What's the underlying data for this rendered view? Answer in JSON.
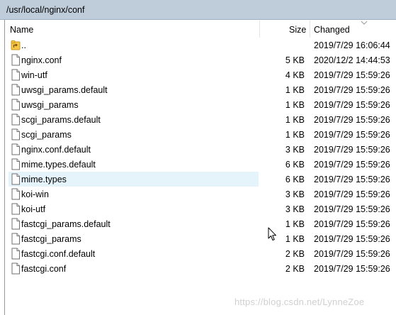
{
  "path": "/usr/local/nginx/conf",
  "columns": {
    "name": "Name",
    "size": "Size",
    "changed": "Changed"
  },
  "files": [
    {
      "name": "..",
      "size": "",
      "changed": "2019/7/29 16:06:44",
      "icon": "parent-folder-icon"
    },
    {
      "name": "nginx.conf",
      "size": "5 KB",
      "changed": "2020/12/2 14:44:53",
      "icon": "file-icon"
    },
    {
      "name": "win-utf",
      "size": "4 KB",
      "changed": "2019/7/29 15:59:26",
      "icon": "file-icon"
    },
    {
      "name": "uwsgi_params.default",
      "size": "1 KB",
      "changed": "2019/7/29 15:59:26",
      "icon": "file-icon"
    },
    {
      "name": "uwsgi_params",
      "size": "1 KB",
      "changed": "2019/7/29 15:59:26",
      "icon": "file-icon"
    },
    {
      "name": "scgi_params.default",
      "size": "1 KB",
      "changed": "2019/7/29 15:59:26",
      "icon": "file-icon"
    },
    {
      "name": "scgi_params",
      "size": "1 KB",
      "changed": "2019/7/29 15:59:26",
      "icon": "file-icon"
    },
    {
      "name": "nginx.conf.default",
      "size": "3 KB",
      "changed": "2019/7/29 15:59:26",
      "icon": "file-icon"
    },
    {
      "name": "mime.types.default",
      "size": "6 KB",
      "changed": "2019/7/29 15:59:26",
      "icon": "file-icon"
    },
    {
      "name": "mime.types",
      "size": "6 KB",
      "changed": "2019/7/29 15:59:26",
      "icon": "file-icon",
      "selected": true
    },
    {
      "name": "koi-win",
      "size": "3 KB",
      "changed": "2019/7/29 15:59:26",
      "icon": "file-icon"
    },
    {
      "name": "koi-utf",
      "size": "3 KB",
      "changed": "2019/7/29 15:59:26",
      "icon": "file-icon"
    },
    {
      "name": "fastcgi_params.default",
      "size": "1 KB",
      "changed": "2019/7/29 15:59:26",
      "icon": "file-icon"
    },
    {
      "name": "fastcgi_params",
      "size": "1 KB",
      "changed": "2019/7/29 15:59:26",
      "icon": "file-icon"
    },
    {
      "name": "fastcgi.conf.default",
      "size": "2 KB",
      "changed": "2019/7/29 15:59:26",
      "icon": "file-icon"
    },
    {
      "name": "fastcgi.conf",
      "size": "2 KB",
      "changed": "2019/7/29 15:59:26",
      "icon": "file-icon"
    }
  ],
  "watermark": "https://blog.csdn.net/LynneZoe",
  "colors": {
    "path_bar": "#bfcddb",
    "selection": "#e5f3fb",
    "folder": "#f5c748"
  }
}
